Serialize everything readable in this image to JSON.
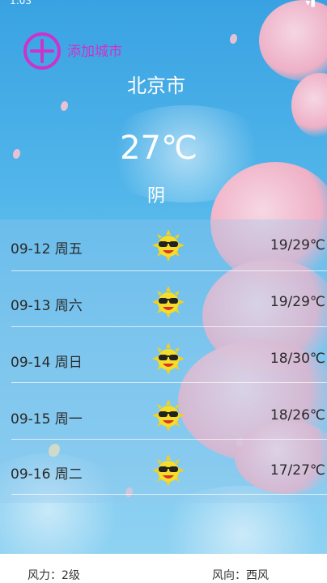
{
  "status_bar": {
    "time": "1:03",
    "signal": "▾▮"
  },
  "header": {
    "add_city_label": "添加城市",
    "city": "北京市",
    "temperature": "27℃",
    "condition": "阴"
  },
  "forecast": [
    {
      "date": "09-12  周五",
      "temp_range": "19/29℃",
      "icon": "sunny-sunglasses-icon"
    },
    {
      "date": "09-13  周六",
      "temp_range": "19/29℃",
      "icon": "sunny-sunglasses-icon"
    },
    {
      "date": "09-14  周日",
      "temp_range": "18/30℃",
      "icon": "sunny-sunglasses-icon"
    },
    {
      "date": "09-15  周一",
      "temp_range": "18/26℃",
      "icon": "sunny-sunglasses-icon"
    },
    {
      "date": "09-16  周二",
      "temp_range": "17/27℃",
      "icon": "sunny-sunglasses-icon"
    }
  ],
  "footer": {
    "wind_power": "风力：2级",
    "wind_direction": "风向：西风"
  },
  "colors": {
    "sky": "#4fb3ea",
    "accent": "#cc33cc",
    "blossom": "#f7b0c4"
  }
}
